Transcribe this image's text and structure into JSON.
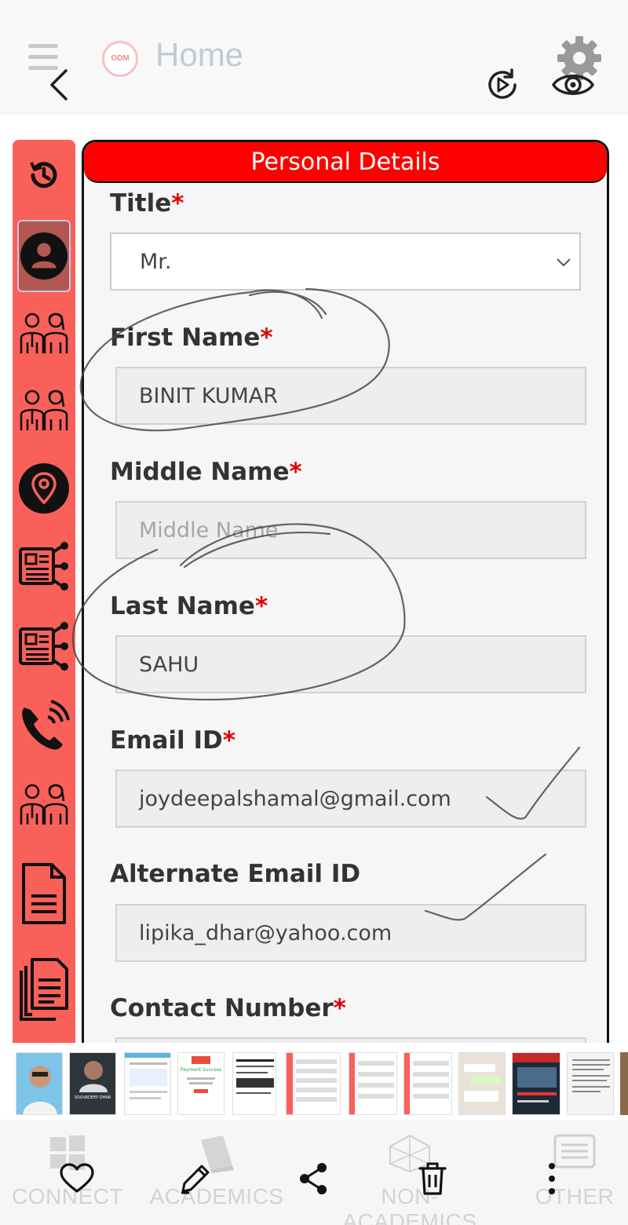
{
  "header": {
    "title": "Home",
    "logo_text": "ODM",
    "menu_icon": "hamburger-icon",
    "back_icon": "back-chevron-icon",
    "settings_icon": "gear-icon",
    "replay_icon": "replay-icon",
    "preview_icon": "eye-icon"
  },
  "sidebar": {
    "accent": "#f9605a",
    "items": [
      {
        "icon": "history-icon"
      },
      {
        "icon": "user-profile-icon",
        "active": true
      },
      {
        "icon": "parents-icon"
      },
      {
        "icon": "guardians-icon"
      },
      {
        "icon": "location-pin-icon"
      },
      {
        "icon": "id-card-icon"
      },
      {
        "icon": "id-card-icon"
      },
      {
        "icon": "phone-icon"
      },
      {
        "icon": "family-icon"
      },
      {
        "icon": "document-icon"
      },
      {
        "icon": "documents-icon"
      }
    ]
  },
  "form": {
    "section_title": "Personal Details",
    "header_color": "#ff0000",
    "required_marker": "*",
    "title": {
      "label": "Title",
      "value": "Mr."
    },
    "first_name": {
      "label": "First Name",
      "value": "BINIT KUMAR"
    },
    "middle_name": {
      "label": "Middle Name",
      "placeholder": "Middle Name"
    },
    "last_name": {
      "label": "Last Name",
      "value": "SAHU"
    },
    "email": {
      "label": "Email ID",
      "value": "joydeepalshamal@gmail.com"
    },
    "alt_email": {
      "label": "Alternate Email ID",
      "value": "lipika_dhar@yahoo.com"
    },
    "contact": {
      "label": "Contact Number"
    }
  },
  "thumbnails": {
    "thumb2_caption": "SOUVADEEP DHAR",
    "thumb4_title": "Payment Success",
    "thumb3_school": "ODM Public School"
  },
  "bottom_nav": {
    "tabs": [
      {
        "label": "CONNECT"
      },
      {
        "label": "ACADEMICS"
      },
      {
        "label": "NON-ACADEMICS"
      },
      {
        "label": "OTHER"
      }
    ],
    "actions": [
      {
        "icon": "heart-icon"
      },
      {
        "icon": "pencil-icon"
      },
      {
        "icon": "share-icon"
      },
      {
        "icon": "trash-icon"
      },
      {
        "icon": "more-vertical-icon"
      }
    ]
  }
}
